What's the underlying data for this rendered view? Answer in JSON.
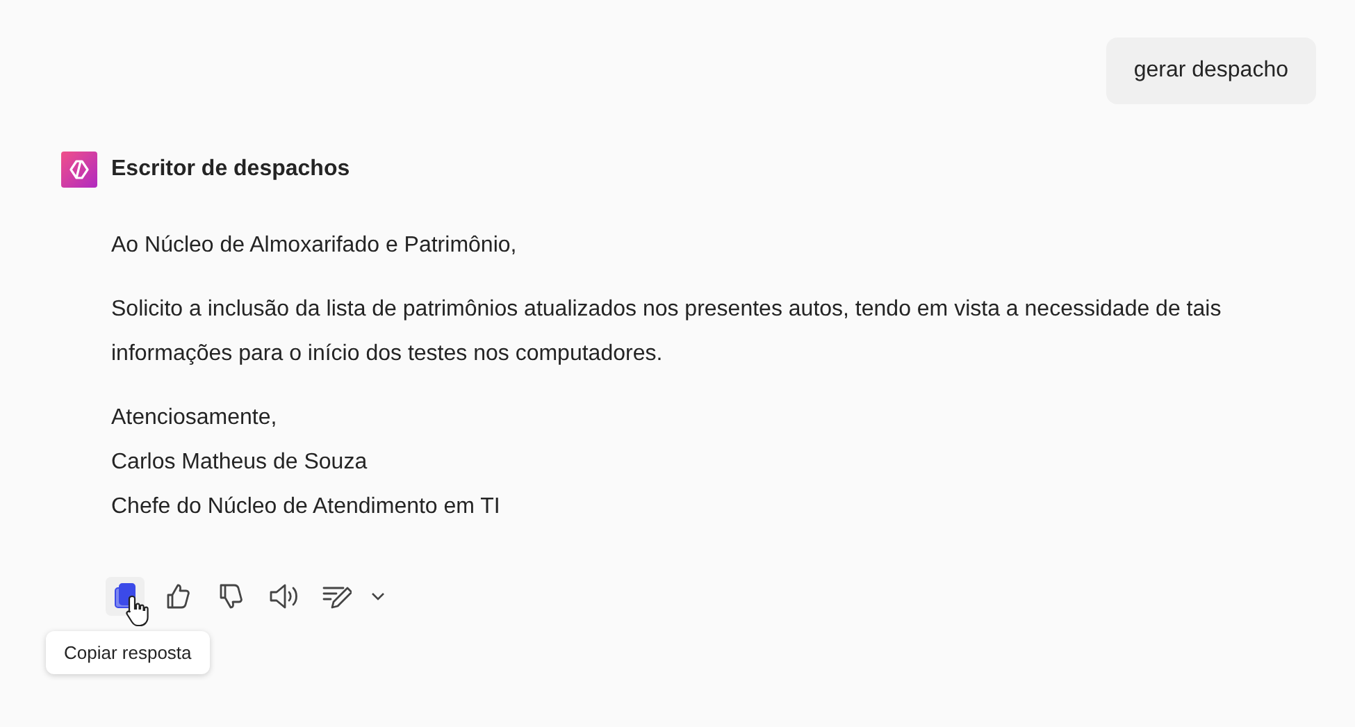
{
  "user_message": {
    "text": "gerar despacho"
  },
  "bot": {
    "name": "Escritor de despachos",
    "paragraphs": [
      {
        "lines": [
          "Ao Núcleo de Almoxarifado e Patrimônio,"
        ]
      },
      {
        "lines": [
          "Solicito a inclusão da lista de patrimônios atualizados nos presentes autos, tendo em vista a necessidade de tais informações para o início dos testes nos computadores."
        ]
      },
      {
        "lines": [
          "Atenciosamente,",
          "Carlos Matheus de Souza",
          "Chefe do Núcleo de Atendimento em TI"
        ]
      }
    ]
  },
  "actions": [
    {
      "kind": "copy",
      "hovered": true
    },
    {
      "kind": "like",
      "hovered": false
    },
    {
      "kind": "dislike",
      "hovered": false
    },
    {
      "kind": "speak",
      "hovered": false
    },
    {
      "kind": "edit",
      "hovered": false
    }
  ],
  "tooltip": {
    "text": "Copiar resposta"
  }
}
